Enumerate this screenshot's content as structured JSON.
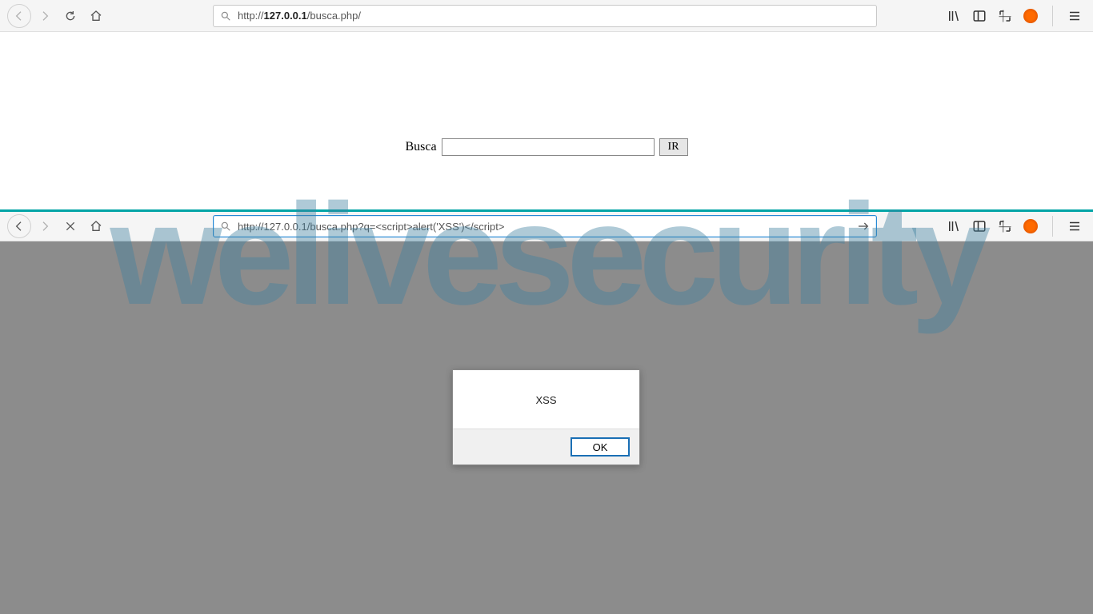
{
  "watermark": "welivesecurity",
  "top_toolbar": {
    "url_prefix": "http://",
    "url_bold": "127.0.0.1",
    "url_suffix": "/busca.php/"
  },
  "top_page": {
    "label": "Busca",
    "button": "IR"
  },
  "bottom_toolbar": {
    "url": "http://127.0.0.1/busca.php?q=<script>alert('XSS')</script>"
  },
  "alert": {
    "message": "XSS",
    "ok": "OK"
  }
}
